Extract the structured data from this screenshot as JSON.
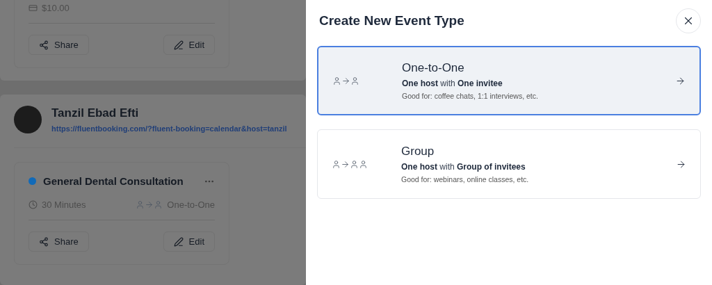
{
  "background": {
    "top_card": {
      "price": "$10.00",
      "buttons": [
        {
          "kind": "share",
          "label": "Share"
        },
        {
          "kind": "edit",
          "label": "Edit"
        }
      ]
    },
    "host": {
      "name": "Tanzil Ebad Efti",
      "url": "https://fluentbooking.com/?fluent-booking=calendar&host=tanzil"
    },
    "event_card": {
      "title": "General Dental Consultation",
      "color": "#116ab8",
      "duration": "30 Minutes",
      "type": "One-to-One",
      "buttons": [
        {
          "kind": "share",
          "label": "Share"
        },
        {
          "kind": "edit",
          "label": "Edit"
        }
      ]
    }
  },
  "drawer": {
    "title": "Create New Event Type",
    "options": [
      {
        "kind": "one",
        "title": "One-to-One",
        "subtitle": "**One host** with **One invitee**",
        "note": "Good for: coffee chats, 1:1 interviews, etc.",
        "selected": true
      },
      {
        "kind": "group",
        "title": "Group",
        "subtitle": "**One host** with **Group of invitees**",
        "note": "Good for: webinars, online classes, etc.",
        "selected": false
      }
    ]
  }
}
